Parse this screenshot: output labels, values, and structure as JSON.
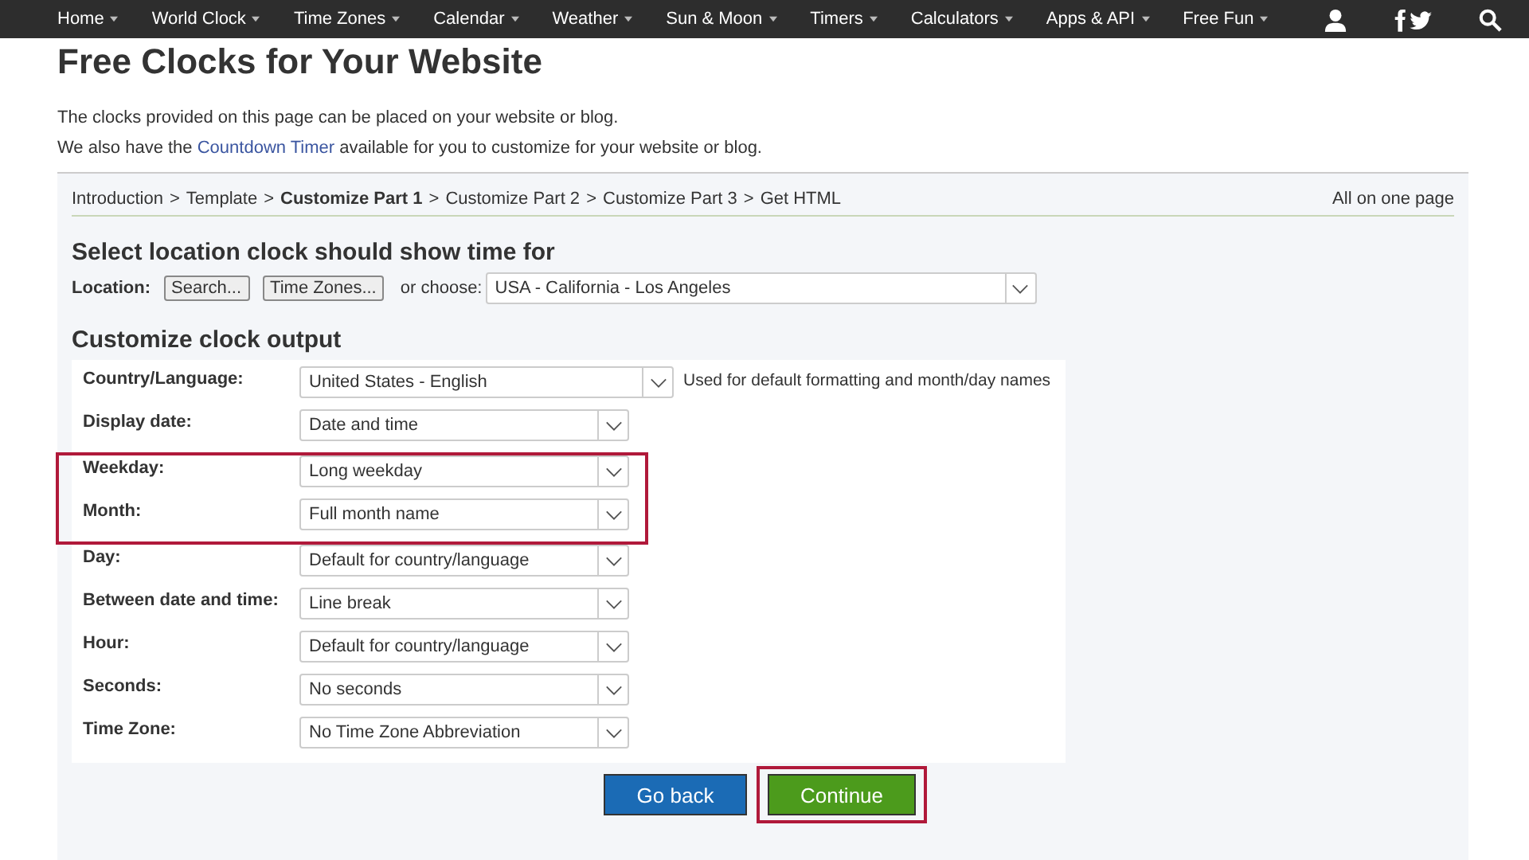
{
  "nav": {
    "items": [
      {
        "label": "Home"
      },
      {
        "label": "World Clock"
      },
      {
        "label": "Time Zones"
      },
      {
        "label": "Calendar"
      },
      {
        "label": "Weather"
      },
      {
        "label": "Sun & Moon"
      },
      {
        "label": "Timers"
      },
      {
        "label": "Calculators"
      },
      {
        "label": "Apps & API"
      },
      {
        "label": "Free Fun"
      }
    ]
  },
  "title": "Free Clocks for Your Website",
  "intro": [
    "The clocks provided on this page can be placed on your website or blog.",
    {
      "before": "We also have the ",
      "link": "Countdown Timer",
      "after": " available for you to customize for your website or blog."
    }
  ],
  "breadcrumb": {
    "steps": [
      {
        "label": "Introduction",
        "selected": false
      },
      {
        "label": "Template",
        "selected": false
      },
      {
        "label": "Customize Part 1",
        "selected": true
      },
      {
        "label": "Customize Part 2",
        "selected": false
      },
      {
        "label": "Customize Part 3",
        "selected": false
      },
      {
        "label": "Get HTML",
        "selected": false
      }
    ],
    "separator": ">",
    "all_on_one": "All on one page"
  },
  "location": {
    "heading": "Select location clock should show time for",
    "label": "Location:",
    "buttons": [
      "Search...",
      "Time Zones..."
    ],
    "or_choose": "or choose:",
    "value": "USA - California - Los Angeles"
  },
  "customize": {
    "heading": "Customize clock output",
    "rows": [
      {
        "label": "Country/Language:",
        "value": "United States - English",
        "note": "Used for default formatting and month/day names",
        "wide": true,
        "highlighted": false
      },
      {
        "label": "Display date:",
        "value": "Date and time",
        "wide": false,
        "highlighted": false
      },
      {
        "label": "Weekday:",
        "value": "Long weekday",
        "wide": false,
        "highlighted": true
      },
      {
        "label": "Month:",
        "value": "Full month name",
        "wide": false,
        "highlighted": true
      },
      {
        "label": "Day:",
        "value": "Default for country/language",
        "wide": false,
        "highlighted": false
      },
      {
        "label": "Between date and time:",
        "value": "Line break",
        "wide": false,
        "highlighted": false
      },
      {
        "label": "Hour:",
        "value": "Default for country/language",
        "wide": false,
        "highlighted": false
      },
      {
        "label": "Seconds:",
        "value": "No seconds",
        "wide": false,
        "highlighted": false
      },
      {
        "label": "Time Zone:",
        "value": "No Time Zone Abbreviation",
        "wide": false,
        "highlighted": false
      }
    ]
  },
  "actions": {
    "back": "Go back",
    "continue": "Continue",
    "continue_highlighted": true
  }
}
